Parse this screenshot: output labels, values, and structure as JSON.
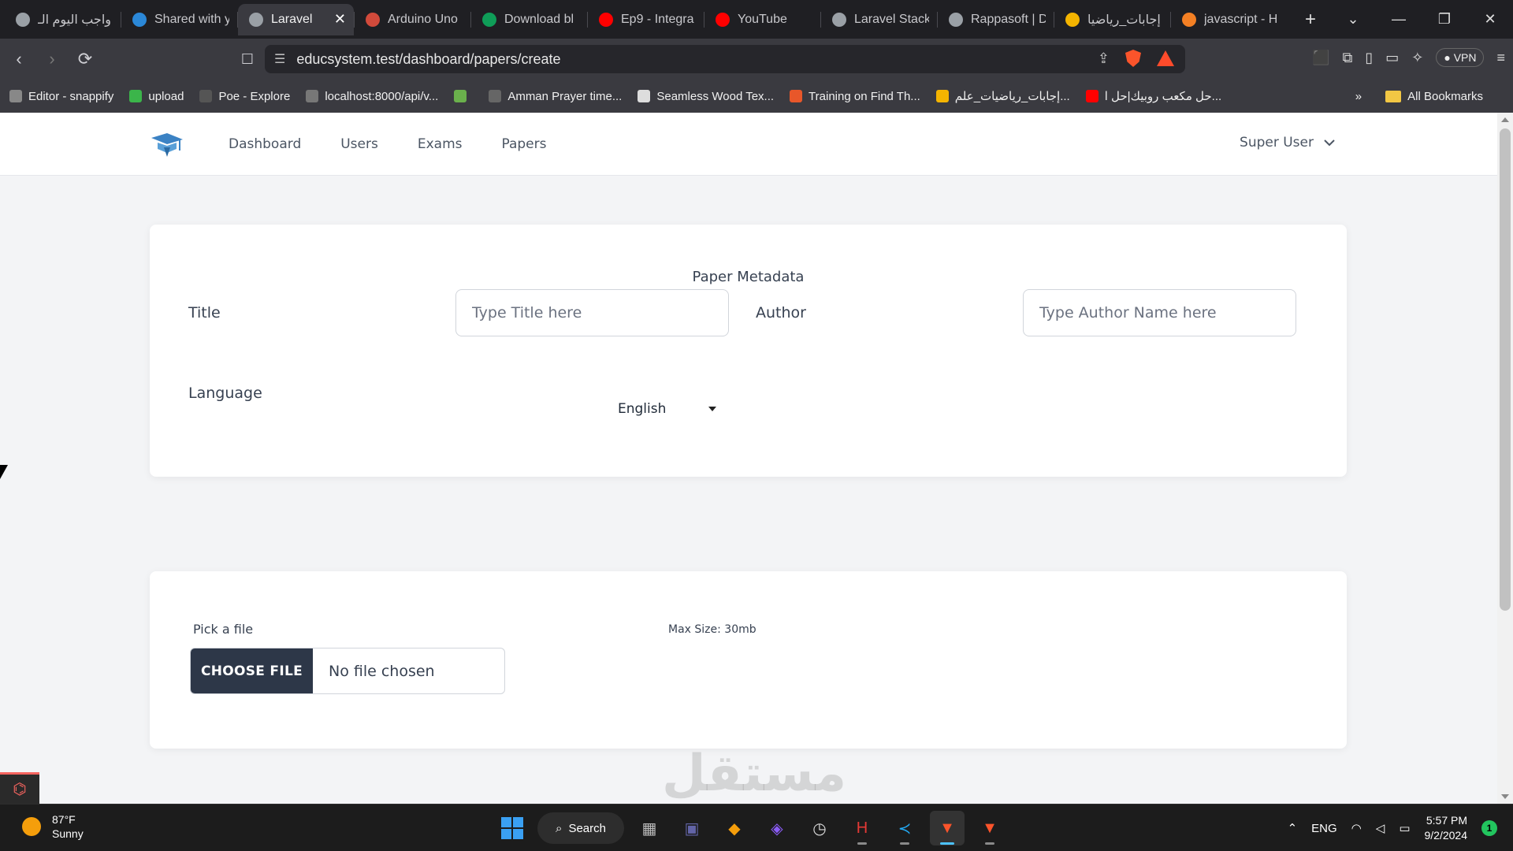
{
  "browser": {
    "tabs": [
      {
        "label": "واجب اليوم الـ",
        "fav_color": "#9aa0a6",
        "icon": "brain-icon"
      },
      {
        "label": "Shared with y",
        "fav_color": "#2b88d8",
        "icon": "cloud-icon"
      },
      {
        "label": "Laravel",
        "fav_color": "#9aa0a6",
        "icon": "globe-icon",
        "active": true
      },
      {
        "label": "Arduino Uno",
        "fav_color": "#d14a3b",
        "icon": "arduino-icon"
      },
      {
        "label": "Download bl",
        "fav_color": "#0f9d58",
        "icon": "diamond-icon"
      },
      {
        "label": "Ep9 - Integra",
        "fav_color": "#ff0000",
        "icon": "youtube-icon"
      },
      {
        "label": "YouTube",
        "fav_color": "#ff0000",
        "icon": "youtube-icon"
      },
      {
        "label": "Laravel Stack",
        "fav_color": "#9aa0a6",
        "icon": "chat-icon"
      },
      {
        "label": "Rappasoft | D",
        "fav_color": "#9aa0a6",
        "icon": "globe-icon"
      },
      {
        "label": "إجابات_رياضيا",
        "fav_color": "#f4b400",
        "icon": "drive-icon"
      },
      {
        "label": "javascript - H",
        "fav_color": "#f48024",
        "icon": "stackoverflow-icon"
      }
    ],
    "url": "educsystem.test/dashboard/papers/create",
    "vpn_label": "VPN",
    "bookmarks": [
      {
        "label": "Editor - snappify",
        "color": "#888"
      },
      {
        "label": "upload",
        "color": "#3bb54a"
      },
      {
        "label": "Poe - Explore",
        "color": "#555"
      },
      {
        "label": "localhost:8000/api/v...",
        "color": "#777"
      },
      {
        "label": "",
        "color": "#6ab04c"
      },
      {
        "label": "Amman Prayer time...",
        "color": "#666"
      },
      {
        "label": "Seamless Wood Tex...",
        "color": "#ddd"
      },
      {
        "label": "Training on Find Th...",
        "color": "#e8572a"
      },
      {
        "label": "إجابات_رياضيات_علم...",
        "color": "#f4b400"
      },
      {
        "label": "حل مكعب روبيك|حل ا...",
        "color": "#ff0000"
      }
    ],
    "all_bookmarks_label": "All Bookmarks"
  },
  "app": {
    "nav": [
      "Dashboard",
      "Users",
      "Exams",
      "Papers"
    ],
    "user_name": "Super User"
  },
  "metadata_card": {
    "title": "Paper Metadata",
    "title_label": "Title",
    "title_placeholder": "Type Title here",
    "author_label": "Author",
    "author_placeholder": "Type Author Name here",
    "language_label": "Language",
    "language_value": "English"
  },
  "file_card": {
    "pick_label": "Pick a file",
    "max_size": "Max Size: 30mb",
    "choose_button": "CHOOSE FILE",
    "no_file": "No file chosen"
  },
  "watermark": "مستقل",
  "taskbar": {
    "temperature": "87°F",
    "condition": "Sunny",
    "search_label": "Search",
    "language": "ENG",
    "time": "5:57 PM",
    "date": "9/2/2024",
    "notification_count": "1"
  }
}
